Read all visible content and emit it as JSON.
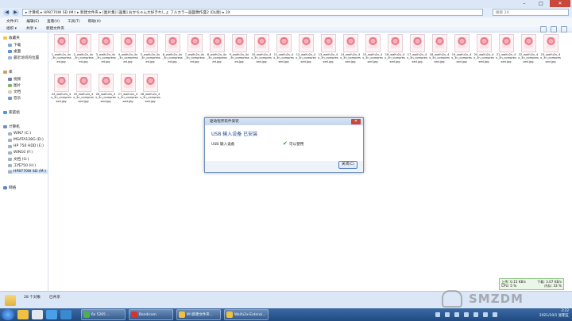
{
  "window": {
    "address_path": "▸ 计算机 ▸ HP8770W SD (M:) ▸ 新建文件夹 ▸ [图片集] [画集] おかちゃん大好きれしょ フルカラー画図像作盛2 (DL版) ▸ 2X",
    "search_placeholder": "搜索 2X",
    "minimize": "–",
    "maximize": "□",
    "close": "✕"
  },
  "menubar": [
    "文件(F)",
    "编辑(E)",
    "查看(V)",
    "工具(T)",
    "帮助(H)"
  ],
  "toolbar": {
    "organize": "组织 ▾",
    "share": "共享 ▾",
    "new_folder": "新建文件夹"
  },
  "sidebar": {
    "favorites": "收藏夹",
    "fav_items": [
      "下载",
      "桌面",
      "最近访问的位置"
    ],
    "libraries": "库",
    "lib_items": [
      "视频",
      "图片",
      "文档",
      "音乐"
    ],
    "homegroup": "家庭组",
    "computer": "计算机",
    "drives": [
      "WIN7 (C:)",
      "MSATA128G (D:)",
      "HP 750 HDD (E:)",
      "WIN10 (F:)",
      "文档 (G:)",
      "工作750 (H:)",
      "HP8770W SD (M:)"
    ],
    "network": "网络"
  },
  "files": [
    "1_waifu2x_4x_3n_compressed.jpg",
    "2_waifu2x_4x_3n_compressed.jpg",
    "3_waifu2x_4x_3n_compressed.jpg",
    "4_waifu2x_4x_3n_compressed.jpg",
    "5_waifu2x_4x_3n_compressed.jpg",
    "6_waifu2x_4x_3n_compressed.jpg",
    "7_waifu2x_4x_3n_compressed.jpg",
    "8_waifu2x_4x_3n_compressed.jpg",
    "9_waifu2x_4x_3n_compressed.jpg",
    "10_waifu2x_4x_3n_compressed.jpg",
    "11_waifu2x_4x_3n_compressed.jpg",
    "12_waifu2x_4x_3n_compressed.jpg",
    "13_waifu2x_4x_3n_compressed.jpg",
    "14_waifu2x_4x_3n_compressed.jpg",
    "15_waifu2x_4x_3n_compressed.jpg",
    "16_waifu2x_4x_3n_compressed.jpg",
    "17_waifu2x_4x_3n_compressed.jpg",
    "18_waifu2x_4x_3n_compressed.jpg",
    "19_waifu2x_4x_3n_compressed.jpg",
    "20_waifu2x_4x_3n_compressed.jpg",
    "21_waifu2x_4x_3n_compressed.jpg",
    "22_waifu2x_4x_3n_compressed.jpg",
    "23_waifu2x_4x_3n_compressed.jpg",
    "24_waifu2x_4x_3n_compressed.jpg",
    "25_waifu2x_4x_3n_compressed.jpg",
    "26_waifu2x_4x_3n_compressed.jpg",
    "27_waifu2x_4x_3n_compressed.jpg",
    "28_waifu2x_4x_3n_compressed.jpg"
  ],
  "dialog": {
    "title": "驱动程序软件安装",
    "heading": "USB 输入设备 已安装",
    "device": "USB 输入设备",
    "status": "可以使用",
    "close_button": "关闭(C)"
  },
  "statusbar": {
    "count": "28 个对象",
    "size": "已共享"
  },
  "netwidget": {
    "upload": "上传: 0.15 KB/s",
    "download": "下载: 3.07 KB/s",
    "cpu": "CPU: 5 %",
    "memory": "内存: 33 %"
  },
  "taskbar": {
    "tasks": [
      "6x 5265 ...",
      "Bandicam",
      "M:\\新建文件夹...",
      "Waifu2x-Extensi..."
    ],
    "time": "3:22",
    "date": "2021/10/1 星期五"
  },
  "watermark": "SMZDM"
}
